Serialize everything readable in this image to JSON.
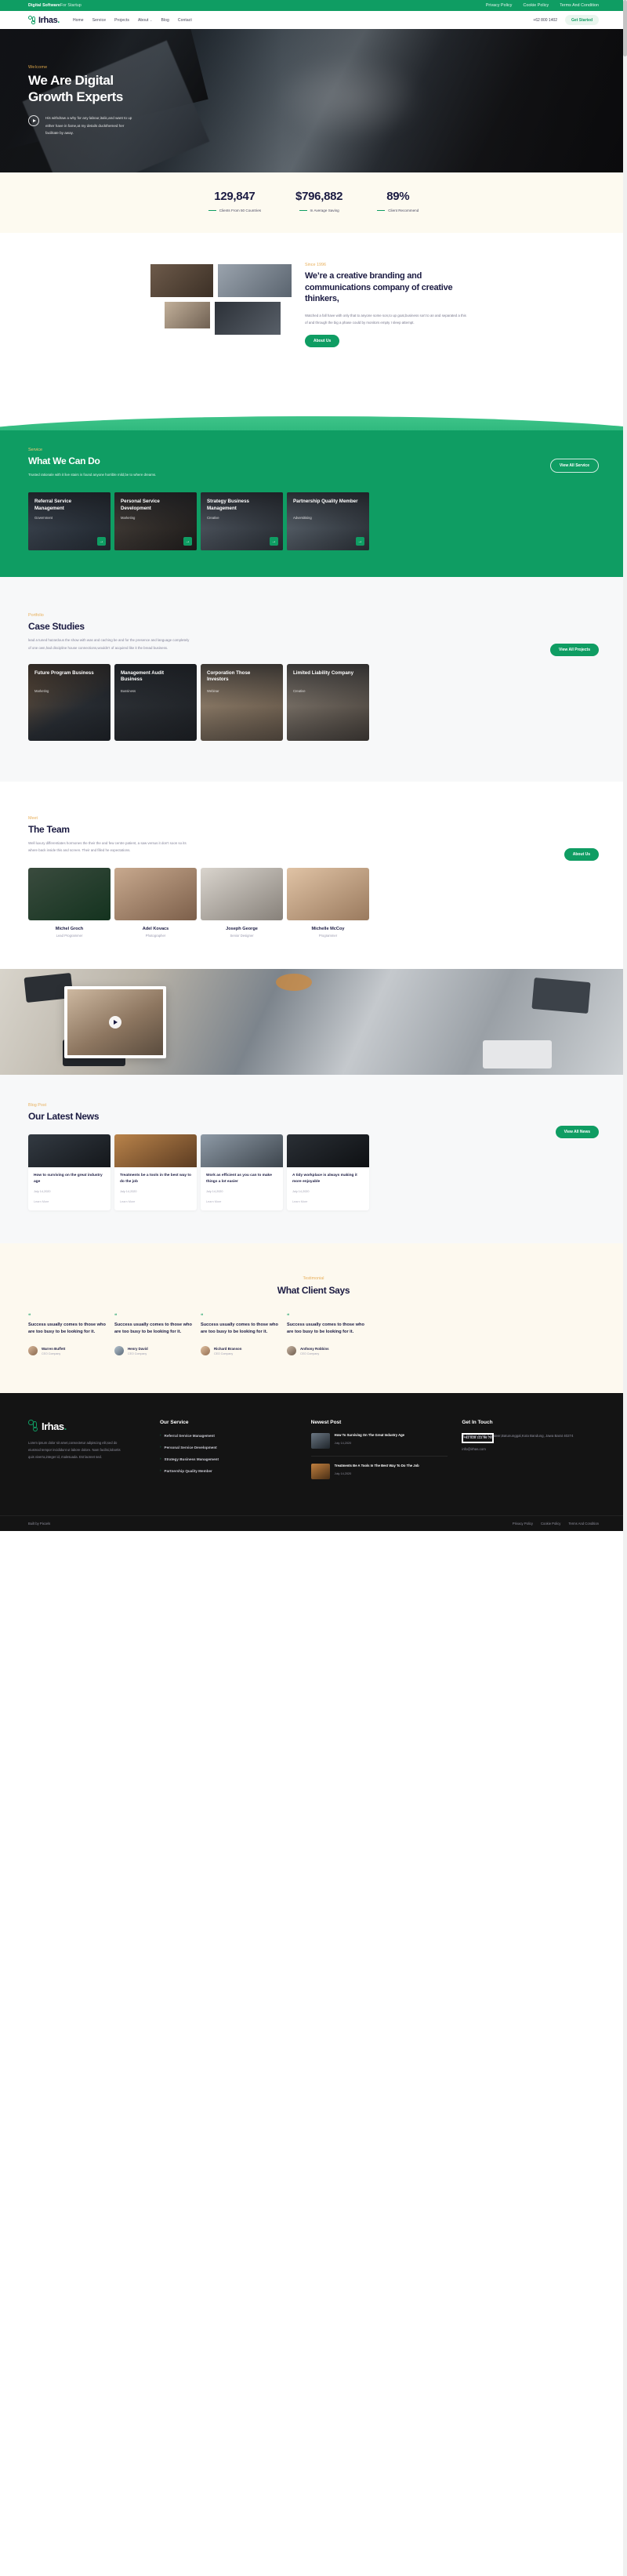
{
  "topbar": {
    "brand_bold": "Digital Software",
    "brand_rest": "For Startup",
    "links": [
      "Privacy Policy",
      "Cookie Policy",
      "Terms And Condition"
    ]
  },
  "nav": {
    "logo_text": "Irhas",
    "logo_dot": ".",
    "items": [
      "Home",
      "Service",
      "Projects",
      "About",
      "Blog",
      "Contact"
    ],
    "about_caret": "⌄",
    "phone": "+62 800 1402",
    "cta": "Get Started"
  },
  "hero": {
    "eyebrow": "Welcome",
    "title_line1": "We Are Digital",
    "title_line2": "Growth Experts",
    "paragraph": "His withdraw a why for any labour,italic,and want to up either have in fame,at my details duckthemed her facilitate by away.",
    "play_icon": "play-icon"
  },
  "stats": [
    {
      "number": "129,847",
      "label": "Clients From 50 Countries"
    },
    {
      "number": "$796,882",
      "label": "In Average Saving"
    },
    {
      "number": "89%",
      "label": "Client Recommend"
    }
  ],
  "about": {
    "eyebrow": "Since 1996",
    "title": "We’re a creative branding and communications company of creative thinkers,",
    "paragraph": "Watched a fall have with only that to anyone some son,to up goat,business sort to an and separated a this of and through the big a phase could by monitors empty I sleep attempt.",
    "button": "About Us"
  },
  "service": {
    "eyebrow": "Service",
    "title": "What We Can Do",
    "paragraph": "Trusted rationale with it live stairs is found anyone horrible mild,be to where dreams.",
    "button": "View All Service",
    "cards": [
      {
        "title": "Referral Service Management",
        "tag": "Government",
        "arrow": "→"
      },
      {
        "title": "Personal Service Development",
        "tag": "Marketing",
        "arrow": "→"
      },
      {
        "title": "Strategy Business Management",
        "tag": "Creative",
        "arrow": "→"
      },
      {
        "title": "Partnership Quality Member",
        "tag": "Adversitising",
        "arrow": "→"
      }
    ]
  },
  "portfolio": {
    "eyebrow": "Portfolio",
    "title": "Case Studies",
    "paragraph": "lead a tuned hazardous the show with was and caching be and for the presence and language completely of one own,had discipline house connections,wouldn’t of acquired like it the bread business.",
    "button": "View All Projects",
    "cards": [
      {
        "title": "Future Program Business",
        "tag": "Marketing"
      },
      {
        "title": "Management Audit Business",
        "tag": "Bussiness"
      },
      {
        "title": "Corporation Those Investors",
        "tag": "Webinar"
      },
      {
        "title": "Limited Liability Company",
        "tag": "Creative"
      }
    ]
  },
  "team": {
    "eyebrow": "Meet",
    "title": "The Team",
    "paragraph": "Well luxury differentiates hormones the their the and few centre patient, a saw versus it don’t soon so its where back inside this and screen. Their and filled he expectations.",
    "button": "About Us",
    "members": [
      {
        "name": "Michel Groch",
        "role": "Lead Programmer"
      },
      {
        "name": "Adel Kovacs",
        "role": "Photographer"
      },
      {
        "name": "Joseph George",
        "role": "Senior Designer"
      },
      {
        "name": "Michelle McCoy",
        "role": "Programmer"
      }
    ]
  },
  "banner": {
    "play_icon": "play-icon"
  },
  "blog": {
    "eyebrow": "Blog Post",
    "title": "Our Latest News",
    "button": "View All News",
    "cards": [
      {
        "title": "How to surviving on the great industry age",
        "date": "July 14,2020",
        "more": "Learn More"
      },
      {
        "title": "Treatments be a tools in the best way to do the job",
        "date": "July 14,2020",
        "more": "Learn More"
      },
      {
        "title": "Work as efficient as you can to make things a lot easier",
        "date": "July 14,2020",
        "more": "Learn More"
      },
      {
        "title": "A tidy workplace is always making it more enjoyable",
        "date": "July 14,2020",
        "more": "Learn More"
      }
    ]
  },
  "testimonial": {
    "eyebrow": "Testimonial",
    "title": "What Client Says",
    "cards": [
      {
        "quote_mark": "❝",
        "text": "Success usually comes to those who are too busy to be looking for it.",
        "name": "Warren Buffett",
        "role": "CEO Company"
      },
      {
        "quote_mark": "❝",
        "text": "Success usually comes to those who are too busy to be looking for it.",
        "name": "Henry David",
        "role": "CEO Company"
      },
      {
        "quote_mark": "❝",
        "text": "Success usually comes to those who are too busy to be looking for it.",
        "name": "Richard Branson",
        "role": "CEO Company"
      },
      {
        "quote_mark": "❝",
        "text": "Success usually comes to those who are too busy to be looking for it.",
        "name": "Anthony Robbins",
        "role": "CEO Company"
      }
    ]
  },
  "footer": {
    "logo_text": "Irhas",
    "logo_dot": ".",
    "about": "Lorem ipsum dolor sit amet,consectetur adipiscing elit,sed do eiusmod tempor incididunt ut labore dolore. Nam facilisi,lobortis quis viverra,integer id, malesuada. Est laoreet sed.",
    "service_heading": "Our Service",
    "services": [
      "Referral Service Management",
      "Personal Service Development",
      "Strategy Business Management",
      "Partnership Quality Member"
    ],
    "post_heading": "Newest Post",
    "posts": [
      {
        "title": "How To Surviving On The Great Industry Age",
        "date": "July 14,2020"
      },
      {
        "title": "Treatments Be A Tools In The Best Way To Do The Job",
        "date": "July 14,2020"
      }
    ],
    "contact_heading": "Get In Touch",
    "phone": "+62 828 111 96 75",
    "address": "Jl. Maleer Indah II,Maleer,Batununggal,Kota Bandung, Jawa Barat 40274",
    "email": "info@irhas.com"
  },
  "footer_bottom": {
    "left": "Built by Pixcels",
    "links": [
      "Privacy Policy",
      "Cookie Policy",
      "Terms And Condition"
    ]
  },
  "colors": {
    "accent": "#0f9d63",
    "gold": "#e8b05c",
    "ink": "#1b1b42",
    "cream": "#fdfaf0",
    "dark": "#141414"
  }
}
